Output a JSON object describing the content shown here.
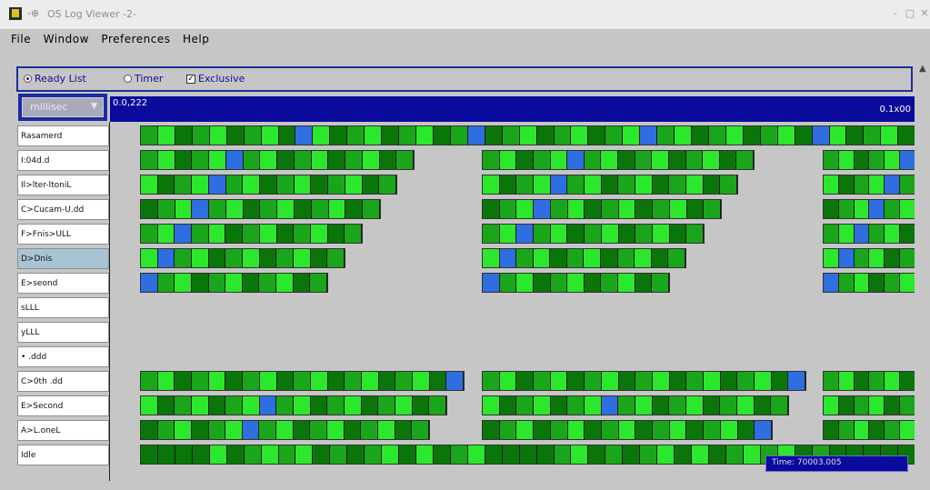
{
  "window": {
    "title": "OS Log Viewer -2-",
    "pin_glyph": "-⊕",
    "minimize": "-",
    "maximize": "□",
    "close": "✕"
  },
  "menu": [
    "File",
    "Window",
    "Preferences",
    "Help"
  ],
  "toolbar": {
    "ready_list": "Ready List",
    "timer": "Timer",
    "exclusive": "Exclusive",
    "ready_list_selected": true,
    "timer_selected": false,
    "exclusive_checked": true
  },
  "unit_select": {
    "value": "millisec"
  },
  "timebar": {
    "start": "0.0,222",
    "end": "0.1x00"
  },
  "tasks": [
    {
      "label": "Rasamerd",
      "selected": false
    },
    {
      "label": "I:04d.d",
      "selected": false
    },
    {
      "label": "Il>lter-ltoniL",
      "selected": false
    },
    {
      "label": "C>Cucam-U.dd",
      "selected": false
    },
    {
      "label": "F>Fnis>ULL",
      "selected": false
    },
    {
      "label": "D>Dnis",
      "selected": true
    },
    {
      "label": "E>seond",
      "selected": false
    },
    {
      "label": "sLLL",
      "selected": false
    },
    {
      "label": "yLLL",
      "selected": false
    },
    {
      "label": "• .ddd",
      "selected": false
    },
    {
      "label": "C>0th .dd",
      "selected": false
    },
    {
      "label": "E>Second",
      "selected": false
    },
    {
      "label": "A>L.oneL",
      "selected": false
    },
    {
      "label": "Idle",
      "selected": false
    }
  ],
  "tooltip": "Time: 70003.005",
  "colors": {
    "accent_blue": "#1a2f96",
    "time_bar": "#0a0a9c",
    "green_bright": "#2ce82c",
    "green_mid": "#1aa61a",
    "green_dark": "#0a760a",
    "blue_marker": "#2f6ee0"
  }
}
